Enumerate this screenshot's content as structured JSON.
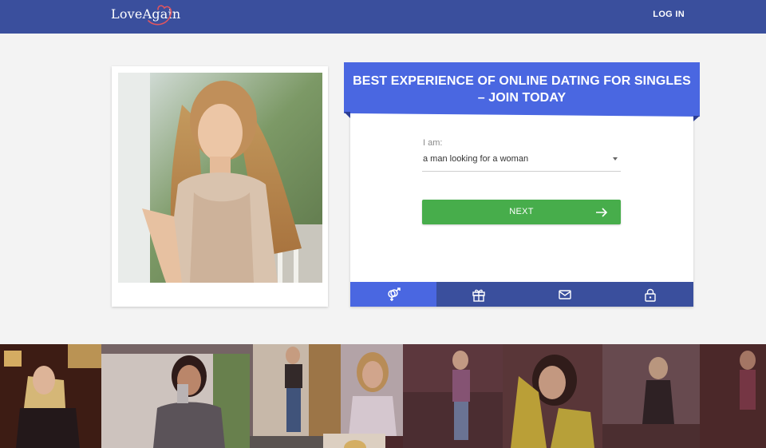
{
  "header": {
    "logo_text": "LoveAgain",
    "login_label": "LOG IN"
  },
  "signup": {
    "title": "BEST EXPERIENCE OF ONLINE DATING FOR SINGLES – JOIN TODAY",
    "iam_label": "I am:",
    "iam_value": "a man looking for a woman",
    "next_label": "NEXT"
  },
  "tabs": [
    {
      "icon": "gender-icon",
      "active": true
    },
    {
      "icon": "gift-icon",
      "active": false
    },
    {
      "icon": "mail-icon",
      "active": false
    },
    {
      "icon": "lock-icon",
      "active": false
    }
  ],
  "colors": {
    "header": "#3a4f9d",
    "banner": "#4a67e1",
    "next_button": "#47ad4b",
    "background": "#f3f3f3"
  }
}
